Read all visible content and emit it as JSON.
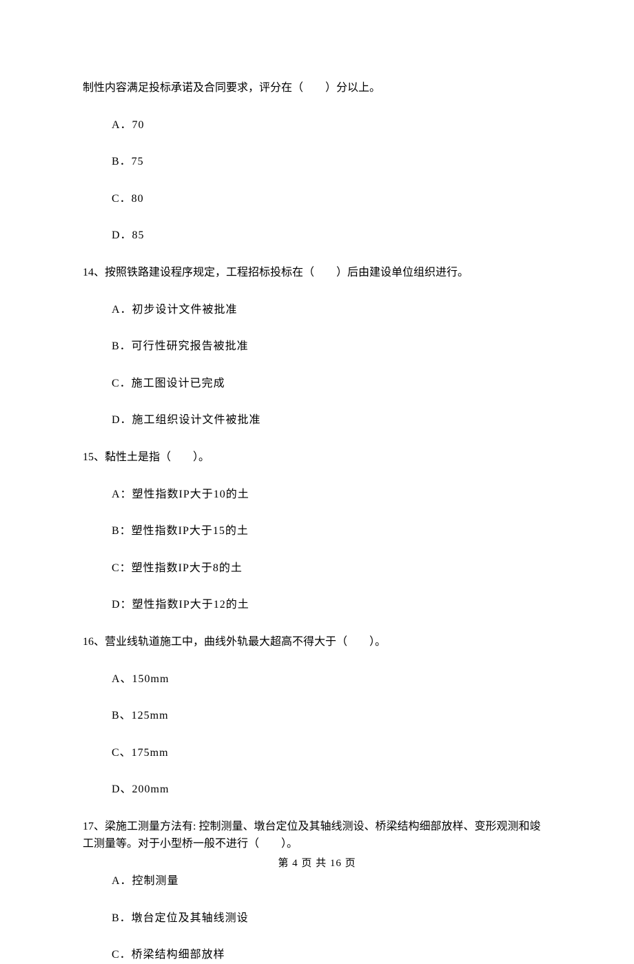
{
  "intro_line": "制性内容满足投标承诺及合同要求，评分在（　　）分以上。",
  "q13_options": {
    "a": "A．70",
    "b": "B．75",
    "c": "C．80",
    "d": "D．85"
  },
  "q14": {
    "stem": "14、按照铁路建设程序规定，工程招标投标在（　　）后由建设单位组织进行。",
    "a": "A．初步设计文件被批准",
    "b": "B．可行性研究报告被批准",
    "c": "C．施工图设计已完成",
    "d": "D．施工组织设计文件被批准"
  },
  "q15": {
    "stem": "15、黏性土是指（　　）。",
    "a": "A：塑性指数IP大于10的土",
    "b": "B：塑性指数IP大于15的土",
    "c": "C：塑性指数IP大于8的土",
    "d": "D：塑性指数IP大于12的土"
  },
  "q16": {
    "stem": "16、营业线轨道施工中，曲线外轨最大超高不得大于（　　）。",
    "a": "A、150mm",
    "b": "B、125mm",
    "c": "C、175mm",
    "d": "D、200mm"
  },
  "q17": {
    "stem": "17、梁施工测量方法有: 控制测量、墩台定位及其轴线测设、桥梁结构细部放样、变形观测和竣工测量等。对于小型桥一般不进行（　　）。",
    "a": "A．控制测量",
    "b": "B．墩台定位及其轴线测设",
    "c": "C．桥梁结构细部放样"
  },
  "footer": "第 4 页 共 16 页"
}
